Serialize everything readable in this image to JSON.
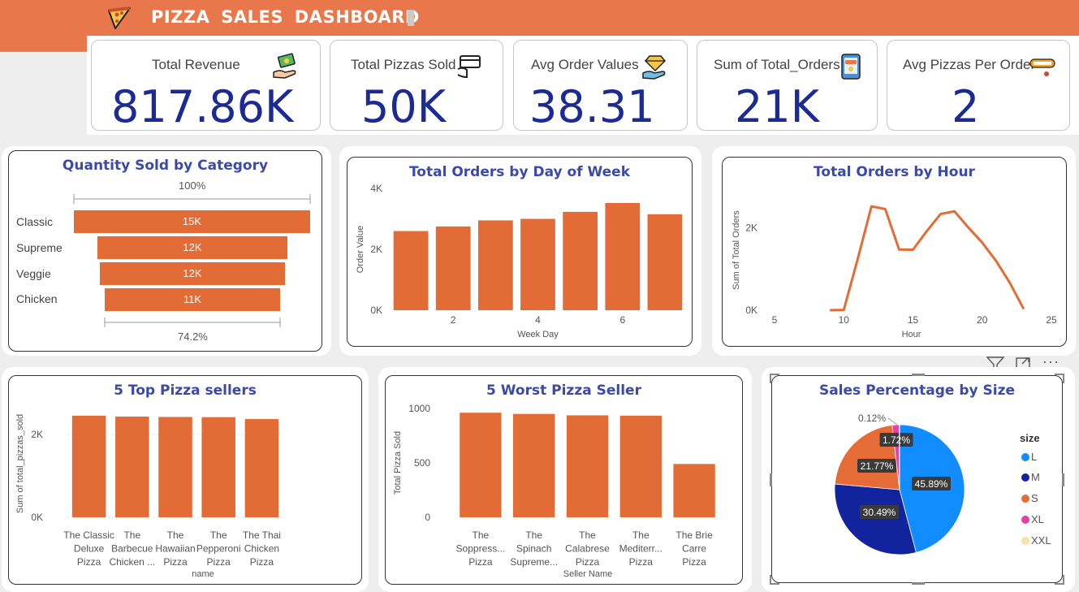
{
  "header": {
    "title": "PIZZA SALES DASHBOARD"
  },
  "kpis": [
    {
      "label": "Total Revenue",
      "value": "817.86K",
      "icon": "money-hand-icon"
    },
    {
      "label": "Total Pizzas Sold",
      "value": "50K",
      "icon": "hand-card-icon"
    },
    {
      "label": "Avg Order Values",
      "value": "38.31",
      "icon": "diamond-hand-icon"
    },
    {
      "label": "Sum of Total_Orders",
      "value": "21K",
      "icon": "order-phone-icon"
    },
    {
      "label": "Avg Pizzas Per Order",
      "value": "2",
      "icon": "order-tag-icon"
    }
  ],
  "funnel": {
    "title": "Quantity Sold by Category",
    "top_pct": "100%",
    "bottom_pct": "74.2%",
    "stages": [
      {
        "label": "Classic",
        "value_label": "15K"
      },
      {
        "label": "Supreme",
        "value_label": "12K"
      },
      {
        "label": "Veggie",
        "value_label": "12K"
      },
      {
        "label": "Chicken",
        "value_label": "11K"
      }
    ]
  },
  "visual_icons": {
    "filter": "filter-icon",
    "focus": "focus-mode-icon",
    "more": "more-options-icon",
    "more_text": "···"
  },
  "colors": {
    "header": "#e8784c",
    "bar": "#e36c36",
    "kpi_value": "#1c2a93",
    "title": "#3b4aa8"
  },
  "chart_data": [
    {
      "id": "day",
      "type": "bar",
      "title": "Total Orders by Day of Week",
      "xlabel": "Week Day",
      "ylabel": "Order Value",
      "x": [
        1,
        2,
        3,
        4,
        5,
        6,
        7
      ],
      "values": [
        2600,
        2750,
        2950,
        3000,
        3230,
        3520,
        3150
      ],
      "ylim": [
        0,
        4000
      ],
      "yticks": [
        "0K",
        "2K",
        "4K"
      ],
      "xticks": [
        "2",
        "4",
        "6"
      ]
    },
    {
      "id": "hour",
      "type": "line",
      "title": "Total Orders by Hour",
      "xlabel": "Hour",
      "ylabel": "Sum of Total Orders",
      "x": [
        9,
        10,
        11,
        12,
        13,
        14,
        15,
        16,
        17,
        18,
        19,
        20,
        21,
        22,
        23
      ],
      "values": [
        1,
        8,
        1231,
        2520,
        2455,
        1472,
        1468,
        1920,
        2336,
        2399,
        2009,
        1642,
        1198,
        663,
        28
      ],
      "xlim": [
        5,
        25
      ],
      "ylim": [
        0,
        2700
      ],
      "yticks": [
        "0K",
        "2K"
      ],
      "xticks": [
        "5",
        "10",
        "15",
        "20",
        "25"
      ]
    },
    {
      "id": "top5",
      "type": "bar",
      "title": "5 Top Pizza sellers",
      "xlabel": "name",
      "ylabel": "Sum of total_pizzas_sold",
      "categories": [
        [
          "The Classic",
          "Deluxe",
          "Pizza"
        ],
        [
          "The",
          "Barbecue",
          "Chicken ..."
        ],
        [
          "The",
          "Hawaiian",
          "Pizza"
        ],
        [
          "The",
          "Pepperoni",
          "Pizza"
        ],
        [
          "The Thai",
          "Chicken",
          "Pizza"
        ]
      ],
      "values": [
        2453,
        2432,
        2422,
        2418,
        2371
      ],
      "ylim": [
        0,
        3000
      ],
      "yticks": [
        "0K",
        "2K"
      ]
    },
    {
      "id": "worst5",
      "type": "bar",
      "title": "5 Worst Pizza Seller",
      "xlabel": "Seller Name",
      "ylabel": "Total Pizza Sold",
      "categories": [
        [
          "The",
          "Soppress...",
          "Pizza"
        ],
        [
          "The",
          "Spinach",
          "Supreme..."
        ],
        [
          "The",
          "Calabrese",
          "Pizza"
        ],
        [
          "The",
          "Mediterr...",
          "Pizza"
        ],
        [
          "The Brie",
          "Carre",
          "Pizza"
        ]
      ],
      "values": [
        961,
        950,
        937,
        934,
        490
      ],
      "ylim": [
        0,
        1000
      ],
      "yticks": [
        "0",
        "500",
        "1000"
      ]
    },
    {
      "id": "size",
      "type": "pie",
      "title": "Sales Percentage by Size",
      "legend_title": "size",
      "slices": [
        {
          "name": "L",
          "value": 45.89,
          "label": "45.89%",
          "color": "#118dff"
        },
        {
          "name": "M",
          "value": 30.49,
          "label": "30.49%",
          "color": "#12239e"
        },
        {
          "name": "S",
          "value": 21.77,
          "label": "21.77%",
          "color": "#e66c37"
        },
        {
          "name": "XL",
          "value": 1.72,
          "label": "1.72%",
          "color": "#e044a7"
        },
        {
          "name": "XXL",
          "value": 0.12,
          "label": "0.12%",
          "color": "#f2e5a8"
        }
      ]
    }
  ]
}
